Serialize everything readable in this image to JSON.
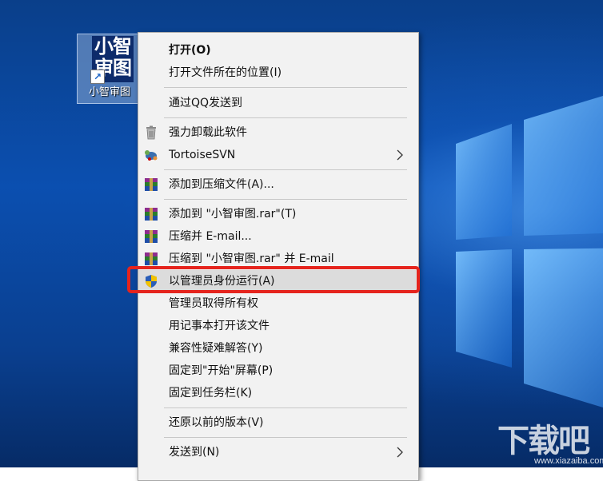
{
  "desktop": {
    "shortcut": {
      "icon_text_line1": "小智",
      "icon_text_line2": "审图",
      "label": "小智审图"
    },
    "watermark": {
      "text": "下载吧",
      "url": "www.xiazaiba.com"
    }
  },
  "context_menu": {
    "items": [
      {
        "label": "打开(O)",
        "icon": "none",
        "bold": true
      },
      {
        "label": "打开文件所在的位置(I)",
        "icon": "none"
      },
      {
        "label": "通过QQ发送到",
        "icon": "none"
      },
      {
        "label": "强力卸载此软件",
        "icon": "trash-icon"
      },
      {
        "label": "TortoiseSVN",
        "icon": "tortoisesvn-icon",
        "submenu": true
      },
      {
        "label": "添加到压缩文件(A)...",
        "icon": "winrar-icon"
      },
      {
        "label": "添加到 \"小智审图.rar\"(T)",
        "icon": "winrar-icon"
      },
      {
        "label": "压缩并 E-mail...",
        "icon": "winrar-icon"
      },
      {
        "label": "压缩到 \"小智审图.rar\" 并 E-mail",
        "icon": "winrar-icon"
      },
      {
        "label": "以管理员身份运行(A)",
        "icon": "uac-shield-icon",
        "highlighted": true
      },
      {
        "label": "管理员取得所有权",
        "icon": "none"
      },
      {
        "label": "用记事本打开该文件",
        "icon": "none"
      },
      {
        "label": "兼容性疑难解答(Y)",
        "icon": "none"
      },
      {
        "label": "固定到\"开始\"屏幕(P)",
        "icon": "none"
      },
      {
        "label": "固定到任务栏(K)",
        "icon": "none"
      },
      {
        "label": "还原以前的版本(V)",
        "icon": "none"
      },
      {
        "label": "发送到(N)",
        "icon": "none",
        "submenu": true
      }
    ]
  },
  "colors": {
    "highlight_box": "#e5241d",
    "menu_background": "#f2f2f2",
    "hover_background": "#dcdcdc",
    "desktop_blue": "#0b4fb0"
  }
}
